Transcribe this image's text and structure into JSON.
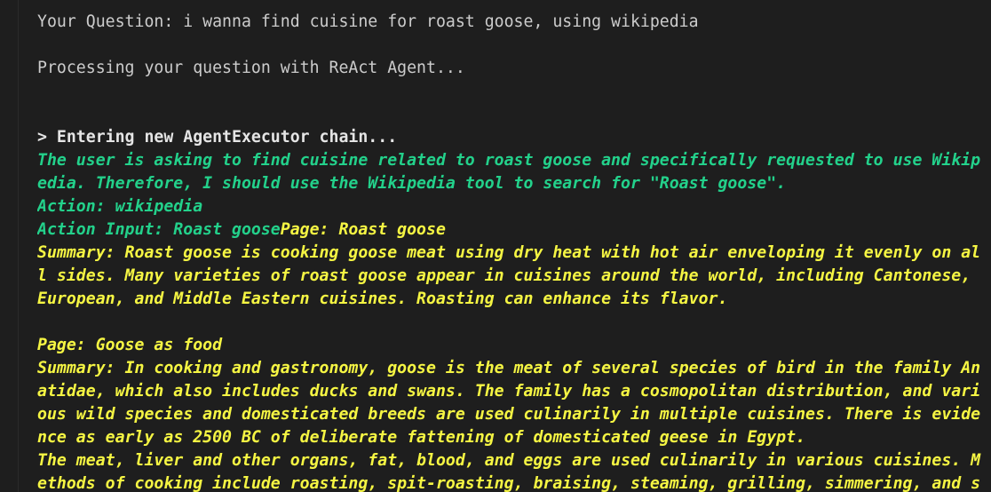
{
  "lines": [
    {
      "segments": [
        {
          "text": "Your Question: i wanna find cuisine for roast goose, using wikipedia",
          "style": "plain"
        }
      ]
    },
    {
      "segments": [
        {
          "text": "",
          "style": "plain"
        }
      ]
    },
    {
      "segments": [
        {
          "text": "Processing your question with ReAct Agent...",
          "style": "plain"
        }
      ]
    },
    {
      "segments": [
        {
          "text": "",
          "style": "plain"
        }
      ]
    },
    {
      "segments": [
        {
          "text": "",
          "style": "plain"
        }
      ]
    },
    {
      "segments": [
        {
          "text": "> Entering new AgentExecutor chain...",
          "style": "bold"
        }
      ]
    },
    {
      "segments": [
        {
          "text": "The user is asking to find cuisine related to roast goose and specifically requested to use Wikip",
          "style": "green"
        }
      ]
    },
    {
      "segments": [
        {
          "text": "edia. Therefore, I should use the Wikipedia tool to search for \"Roast goose\".",
          "style": "green"
        }
      ]
    },
    {
      "segments": [
        {
          "text": "Action: wikipedia",
          "style": "green"
        }
      ]
    },
    {
      "segments": [
        {
          "text": "Action Input: Roast goose",
          "style": "green"
        },
        {
          "text": "Page: Roast goose",
          "style": "yellow"
        }
      ]
    },
    {
      "segments": [
        {
          "text": "Summary: Roast goose is cooking goose meat using dry heat with hot air enveloping it evenly on al",
          "style": "yellow"
        }
      ]
    },
    {
      "segments": [
        {
          "text": "l sides. Many varieties of roast goose appear in cuisines around the world, including Cantonese, ",
          "style": "yellow"
        }
      ]
    },
    {
      "segments": [
        {
          "text": "European, and Middle Eastern cuisines. Roasting can enhance its flavor.",
          "style": "yellow"
        }
      ]
    },
    {
      "segments": [
        {
          "text": "",
          "style": "plain"
        }
      ]
    },
    {
      "segments": [
        {
          "text": "Page: Goose as food",
          "style": "yellow"
        }
      ]
    },
    {
      "segments": [
        {
          "text": "Summary: In cooking and gastronomy, goose is the meat of several species of bird in the family An",
          "style": "yellow"
        }
      ]
    },
    {
      "segments": [
        {
          "text": "atidae, which also includes ducks and swans. The family has a cosmopolitan distribution, and vari",
          "style": "yellow"
        }
      ]
    },
    {
      "segments": [
        {
          "text": "ous wild species and domesticated breeds are used culinarily in multiple cuisines. There is evide",
          "style": "yellow"
        }
      ]
    },
    {
      "segments": [
        {
          "text": "nce as early as 2500 BC of deliberate fattening of domesticated geese in Egypt.",
          "style": "yellow"
        }
      ]
    },
    {
      "segments": [
        {
          "text": "The meat, liver and other organs, fat, blood, and eggs are used culinarily in various cuisines. M",
          "style": "yellow"
        }
      ]
    },
    {
      "segments": [
        {
          "text": "ethods of cooking include roasting, spit-roasting, braising, steaming, grilling, simmering, and s",
          "style": "yellow"
        }
      ]
    }
  ]
}
